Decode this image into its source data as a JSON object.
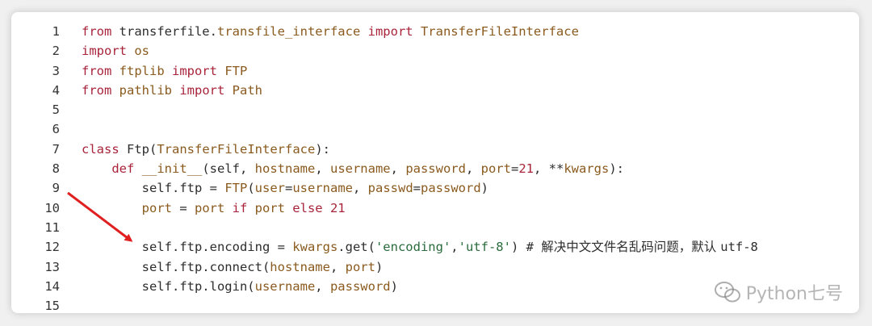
{
  "code_lines": [
    {
      "n": "1",
      "tokens": [
        {
          "t": "from",
          "c": "kw"
        },
        {
          "t": " transferfile.",
          "c": "nm"
        },
        {
          "t": "transfile_interface",
          "c": "ty"
        },
        {
          "t": " import ",
          "c": "kw"
        },
        {
          "t": "TransferFileInterface",
          "c": "ty"
        }
      ]
    },
    {
      "n": "2",
      "tokens": [
        {
          "t": "import",
          "c": "kw"
        },
        {
          "t": " os",
          "c": "ty"
        }
      ]
    },
    {
      "n": "3",
      "tokens": [
        {
          "t": "from",
          "c": "kw"
        },
        {
          "t": " ftplib ",
          "c": "ty"
        },
        {
          "t": "import",
          "c": "kw"
        },
        {
          "t": " FTP",
          "c": "ty"
        }
      ]
    },
    {
      "n": "4",
      "tokens": [
        {
          "t": "from",
          "c": "kw"
        },
        {
          "t": " pathlib ",
          "c": "ty"
        },
        {
          "t": "import",
          "c": "kw"
        },
        {
          "t": " Path",
          "c": "ty"
        }
      ]
    },
    {
      "n": "5",
      "tokens": []
    },
    {
      "n": "6",
      "tokens": []
    },
    {
      "n": "7",
      "tokens": [
        {
          "t": "class",
          "c": "kw"
        },
        {
          "t": " Ftp(",
          "c": "nm"
        },
        {
          "t": "TransferFileInterface",
          "c": "ty"
        },
        {
          "t": "):",
          "c": "nm"
        }
      ]
    },
    {
      "n": "8",
      "tokens": [
        {
          "t": "    ",
          "c": "nm"
        },
        {
          "t": "def",
          "c": "kw"
        },
        {
          "t": " __init__",
          "c": "ty"
        },
        {
          "t": "(self, ",
          "c": "nm"
        },
        {
          "t": "hostname",
          "c": "ty"
        },
        {
          "t": ", ",
          "c": "nm"
        },
        {
          "t": "username",
          "c": "ty"
        },
        {
          "t": ", ",
          "c": "nm"
        },
        {
          "t": "password",
          "c": "ty"
        },
        {
          "t": ", ",
          "c": "nm"
        },
        {
          "t": "port",
          "c": "ty"
        },
        {
          "t": "=",
          "c": "nm"
        },
        {
          "t": "21",
          "c": "kw"
        },
        {
          "t": ", **",
          "c": "nm"
        },
        {
          "t": "kwargs",
          "c": "ty"
        },
        {
          "t": "):",
          "c": "nm"
        }
      ]
    },
    {
      "n": "9",
      "tokens": [
        {
          "t": "        self.ftp = ",
          "c": "nm"
        },
        {
          "t": "FTP",
          "c": "ty"
        },
        {
          "t": "(",
          "c": "nm"
        },
        {
          "t": "user",
          "c": "ty"
        },
        {
          "t": "=",
          "c": "nm"
        },
        {
          "t": "username",
          "c": "ty"
        },
        {
          "t": ", ",
          "c": "nm"
        },
        {
          "t": "passwd",
          "c": "ty"
        },
        {
          "t": "=",
          "c": "nm"
        },
        {
          "t": "password",
          "c": "ty"
        },
        {
          "t": ")",
          "c": "nm"
        }
      ]
    },
    {
      "n": "10",
      "tokens": [
        {
          "t": "        ",
          "c": "nm"
        },
        {
          "t": "port",
          "c": "ty"
        },
        {
          "t": " = ",
          "c": "nm"
        },
        {
          "t": "port",
          "c": "ty"
        },
        {
          "t": " if ",
          "c": "kw"
        },
        {
          "t": "port",
          "c": "ty"
        },
        {
          "t": " else ",
          "c": "kw"
        },
        {
          "t": "21",
          "c": "kw"
        }
      ]
    },
    {
      "n": "11",
      "tokens": []
    },
    {
      "n": "12",
      "tokens": [
        {
          "t": "        self.ftp.encoding = ",
          "c": "nm"
        },
        {
          "t": "kwargs",
          "c": "ty"
        },
        {
          "t": ".get(",
          "c": "nm"
        },
        {
          "t": "'encoding'",
          "c": "st"
        },
        {
          "t": ",",
          "c": "nm"
        },
        {
          "t": "'utf-8'",
          "c": "st"
        },
        {
          "t": ") # ",
          "c": "nm"
        },
        {
          "t": "解决中文文件名乱码问题，默认 ",
          "c": "cm"
        },
        {
          "t": "utf-8",
          "c": "nm"
        }
      ]
    },
    {
      "n": "13",
      "tokens": [
        {
          "t": "        self.ftp.connect(",
          "c": "nm"
        },
        {
          "t": "hostname",
          "c": "ty"
        },
        {
          "t": ", ",
          "c": "nm"
        },
        {
          "t": "port",
          "c": "ty"
        },
        {
          "t": ")",
          "c": "nm"
        }
      ]
    },
    {
      "n": "14",
      "tokens": [
        {
          "t": "        self.ftp.login(",
          "c": "nm"
        },
        {
          "t": "username",
          "c": "ty"
        },
        {
          "t": ", ",
          "c": "nm"
        },
        {
          "t": "password",
          "c": "ty"
        },
        {
          "t": ")",
          "c": "nm"
        }
      ]
    },
    {
      "n": "15",
      "tokens": []
    }
  ],
  "watermark": {
    "text": "Python七号",
    "icon": "wechat-icon"
  },
  "colors": {
    "arrow": "#e02020",
    "keyword": "#a8243a",
    "identifier": "#8a5a1e",
    "string": "#2a6b3c"
  }
}
